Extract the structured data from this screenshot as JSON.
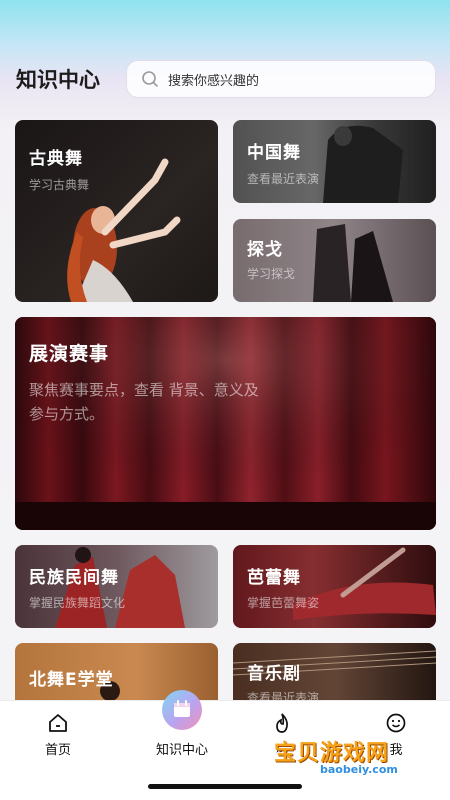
{
  "header": {
    "title": "知识中心",
    "search": {
      "placeholder": "搜索你感兴趣的"
    }
  },
  "cards": {
    "classical": {
      "title": "古典舞",
      "subtitle": "学习古典舞"
    },
    "chinese": {
      "title": "中国舞",
      "subtitle": "查看最近表演"
    },
    "tango": {
      "title": "探戈",
      "subtitle": "学习探戈"
    },
    "show": {
      "title": "展演赛事",
      "subtitle_line1": "聚焦赛事要点，查看 背景、意义及",
      "subtitle_line2": "参与方式。"
    },
    "folk": {
      "title": "民族民间舞",
      "subtitle": "掌握民族舞蹈文化"
    },
    "ballet": {
      "title": "芭蕾舞",
      "subtitle": "掌握芭蕾舞姿"
    },
    "beiwu": {
      "title": "北舞E学堂",
      "subtitle": ""
    },
    "musical": {
      "title": "音乐剧",
      "subtitle": "查看最近表演"
    }
  },
  "tabbar": {
    "items": [
      {
        "label": "首页",
        "icon": "home-icon"
      },
      {
        "label": "知识中心",
        "icon": "calendar-icon",
        "active": true
      },
      {
        "label": "动",
        "icon": "fire-icon"
      },
      {
        "label": "我",
        "icon": "smile-icon"
      }
    ]
  },
  "watermark": {
    "text": "宝贝游戏网",
    "url": "baobeiy.com"
  },
  "colors": {
    "accent_gradient_start": "#7fd6f3",
    "accent_gradient_end": "#f08fb8",
    "watermark": "#f6a21b"
  }
}
